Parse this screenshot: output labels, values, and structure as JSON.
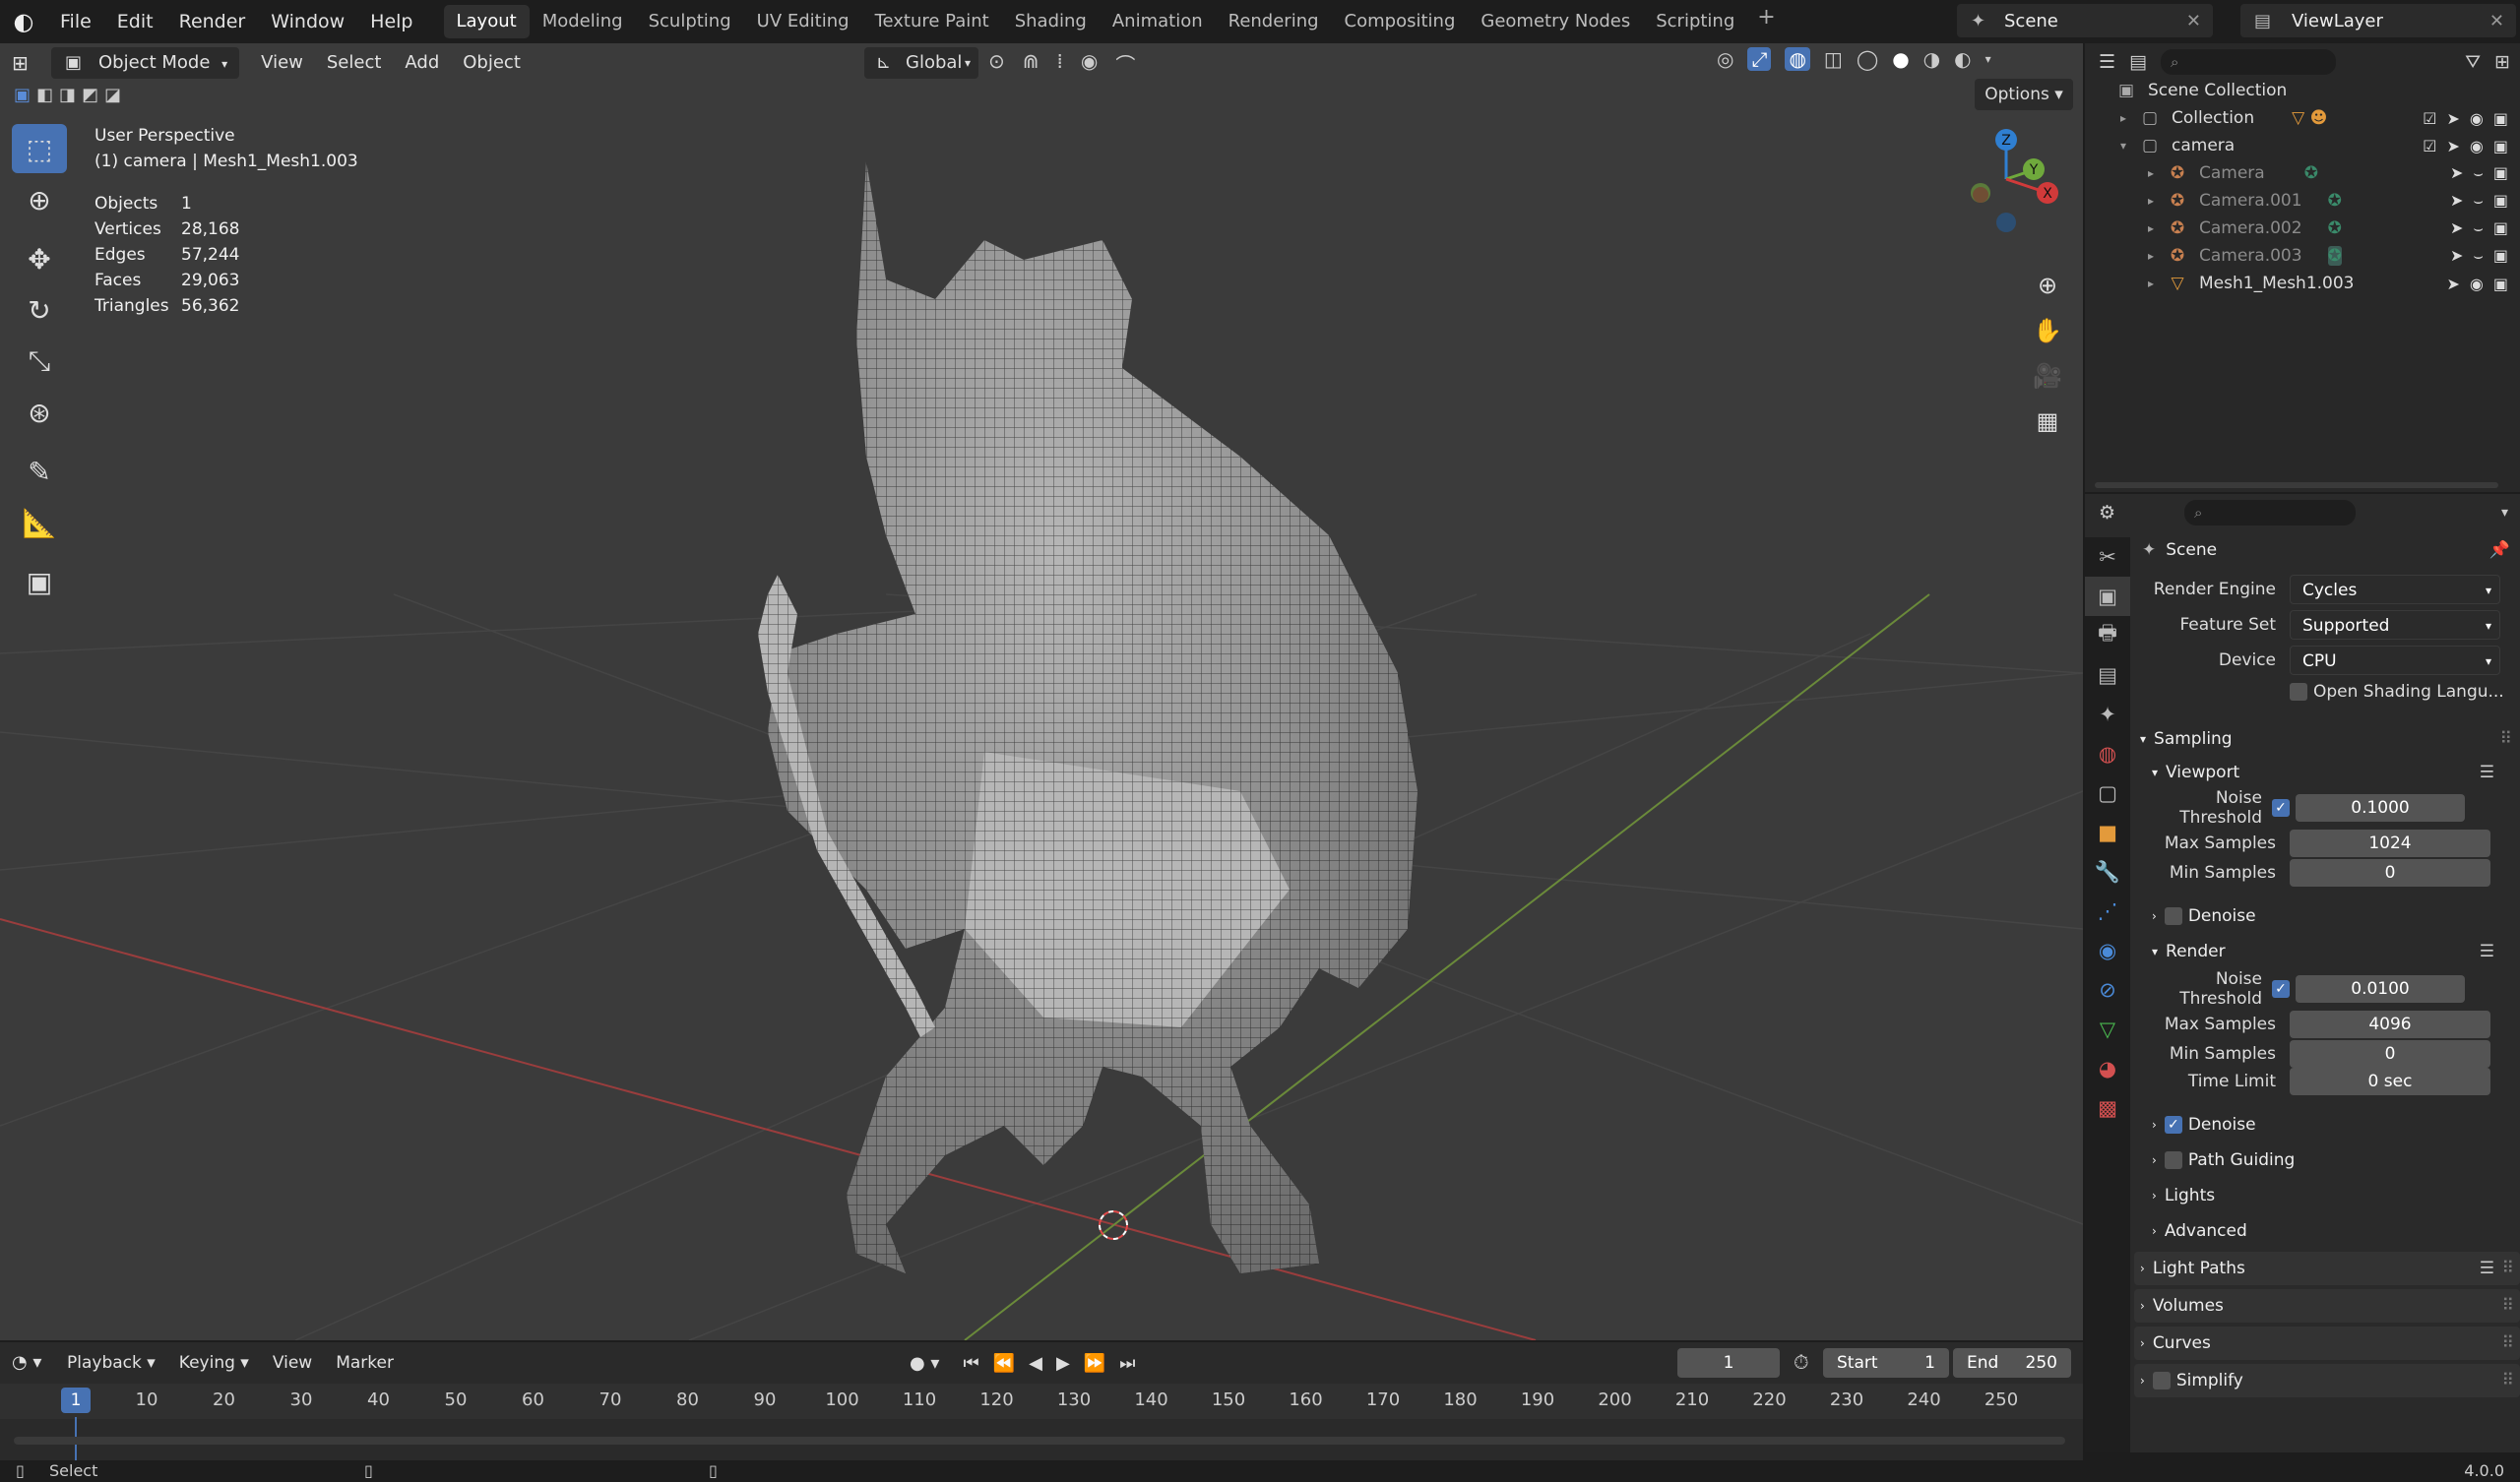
{
  "topbar": {
    "menus": [
      "File",
      "Edit",
      "Render",
      "Window",
      "Help"
    ],
    "workspaces": [
      "Layout",
      "Modeling",
      "Sculpting",
      "UV Editing",
      "Texture Paint",
      "Shading",
      "Animation",
      "Rendering",
      "Compositing",
      "Geometry Nodes",
      "Scripting"
    ],
    "active_workspace": "Layout",
    "scene": "Scene",
    "view_layer": "ViewLayer"
  },
  "viewport": {
    "mode": "Object Mode",
    "menus": [
      "View",
      "Select",
      "Add",
      "Object"
    ],
    "transform_orientation": "Global",
    "options_label": "Options",
    "view_name": "User Perspective",
    "active_info": "(1) camera | Mesh1_Mesh1.003",
    "stats": [
      {
        "k": "Objects",
        "v": "1"
      },
      {
        "k": "Vertices",
        "v": "28,168"
      },
      {
        "k": "Edges",
        "v": "57,244"
      },
      {
        "k": "Faces",
        "v": "29,063"
      },
      {
        "k": "Triangles",
        "v": "56,362"
      }
    ],
    "axis_labels": {
      "x": "X",
      "y": "Y",
      "z": "Z"
    }
  },
  "outliner": {
    "root": "Scene Collection",
    "items": [
      {
        "name": "Collection",
        "level": 1,
        "icon": "collection-icon",
        "dim": false
      },
      {
        "name": "camera",
        "level": 1,
        "icon": "collection-icon",
        "dim": false
      },
      {
        "name": "Camera",
        "level": 2,
        "icon": "camera-object-icon",
        "dim": true
      },
      {
        "name": "Camera.001",
        "level": 2,
        "icon": "camera-object-icon",
        "dim": true
      },
      {
        "name": "Camera.002",
        "level": 2,
        "icon": "camera-object-icon",
        "dim": true
      },
      {
        "name": "Camera.003",
        "level": 2,
        "icon": "camera-object-icon",
        "dim": true
      },
      {
        "name": "Mesh1_Mesh1.003",
        "level": 2,
        "icon": "mesh-object-icon",
        "dim": false
      }
    ]
  },
  "properties": {
    "context": "Scene",
    "render_engine_label": "Render Engine",
    "render_engine": "Cycles",
    "feature_set_label": "Feature Set",
    "feature_set": "Supported",
    "device_label": "Device",
    "device": "CPU",
    "osl_label": "Open Shading Langu...",
    "sampling": "Sampling",
    "viewport_label": "Viewport",
    "noise_threshold_label": "Noise Threshold",
    "vp_noise": "0.1000",
    "max_samples_label": "Max Samples",
    "vp_max": "1024",
    "min_samples_label": "Min Samples",
    "vp_min": "0",
    "denoise_label": "Denoise",
    "render_label": "Render",
    "r_noise": "0.0100",
    "r_max": "4096",
    "r_min": "0",
    "time_limit_label": "Time Limit",
    "r_time": "0 sec",
    "path_guiding_label": "Path Guiding",
    "lights_label": "Lights",
    "advanced_label": "Advanced",
    "light_paths_label": "Light Paths",
    "volumes_label": "Volumes",
    "curves_label": "Curves",
    "simplify_label": "Simplify"
  },
  "timeline": {
    "menus": [
      "Playback",
      "Keying",
      "View",
      "Marker"
    ],
    "current_frame": "1",
    "start_label": "Start",
    "start": "1",
    "end_label": "End",
    "end": "250",
    "ticks": [
      "10",
      "20",
      "30",
      "40",
      "50",
      "60",
      "70",
      "80",
      "90",
      "100",
      "110",
      "120",
      "130",
      "140",
      "150",
      "160",
      "170",
      "180",
      "190",
      "200",
      "210",
      "220",
      "230",
      "240",
      "250"
    ]
  },
  "statusbar": {
    "left": "Select",
    "version": "4.0.0"
  },
  "colors": {
    "accent": "#4772b3",
    "x_axis": "#d13a3a",
    "y_axis": "#6fa93c",
    "z_axis": "#2f7fd1"
  }
}
